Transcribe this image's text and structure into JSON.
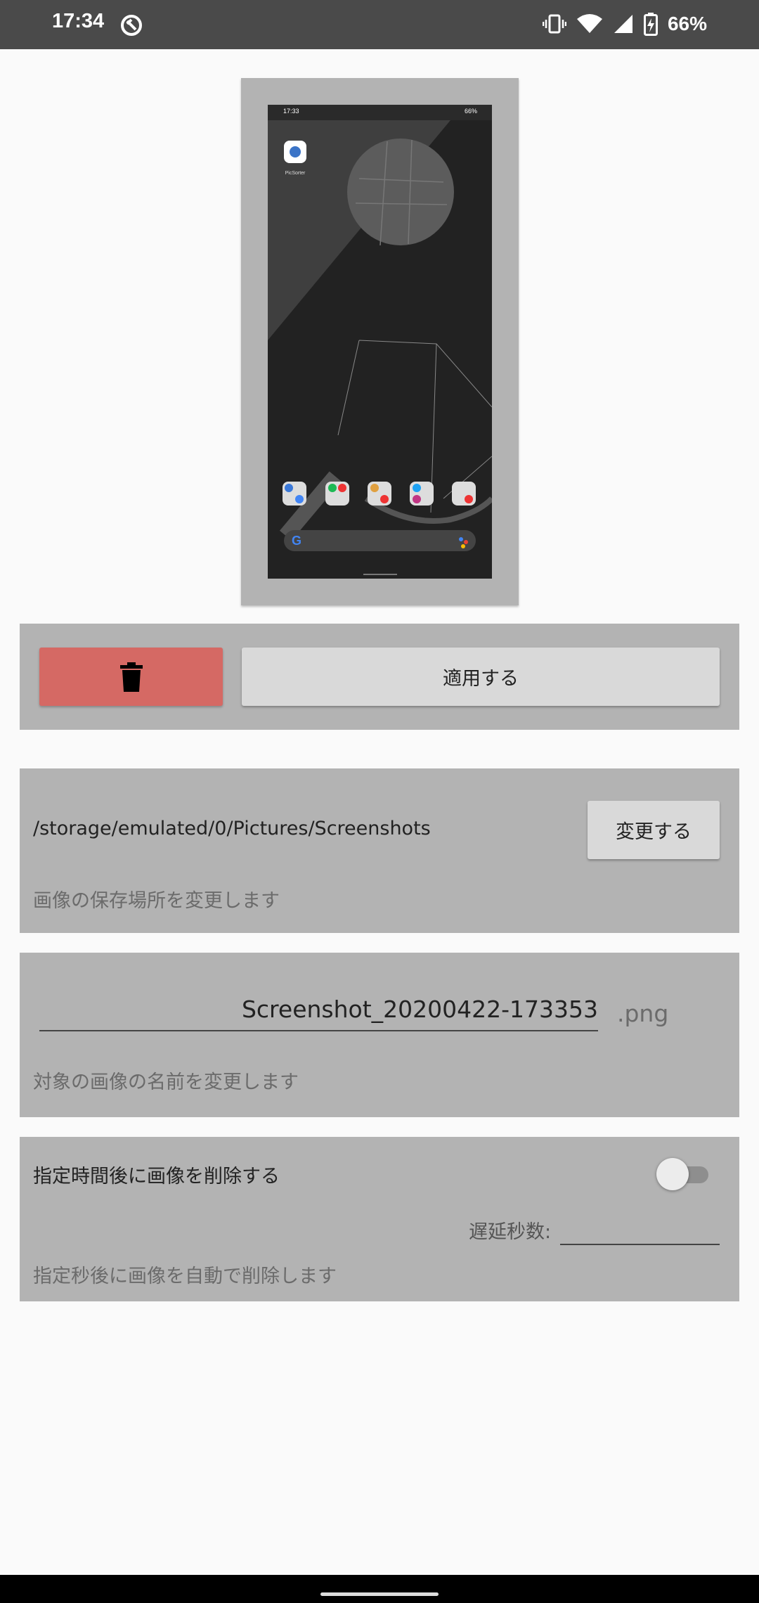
{
  "status_bar": {
    "time": "17:34",
    "battery": "66%",
    "icons": [
      "app-notification-icon",
      "vibrate-icon",
      "wifi-icon",
      "cell-signal-icon",
      "battery-charging-icon"
    ]
  },
  "preview": {
    "screen": {
      "time": "17:33",
      "battery": "66%",
      "app_label": "PicSorter"
    }
  },
  "actions": {
    "delete_icon": "trash-icon",
    "apply_label": "適用する"
  },
  "storage": {
    "path": "/storage/emulated/0/Pictures/Screenshots",
    "change_label": "変更する",
    "description": "画像の保存場所を変更します"
  },
  "rename": {
    "filename": "Screenshot_20200422-173353",
    "extension": ".png",
    "description": "対象の画像の名前を変更します"
  },
  "auto_delete": {
    "label": "指定時間後に画像を削除する",
    "enabled": false,
    "delay_label": "遅延秒数:",
    "delay_value": "",
    "description": "指定秒後に画像を自動で削除します"
  },
  "colors": {
    "delete_button": "#d56964",
    "panel": "#b3b3b3",
    "button": "#d9d9d9",
    "status_bar": "#4a4a4a"
  }
}
